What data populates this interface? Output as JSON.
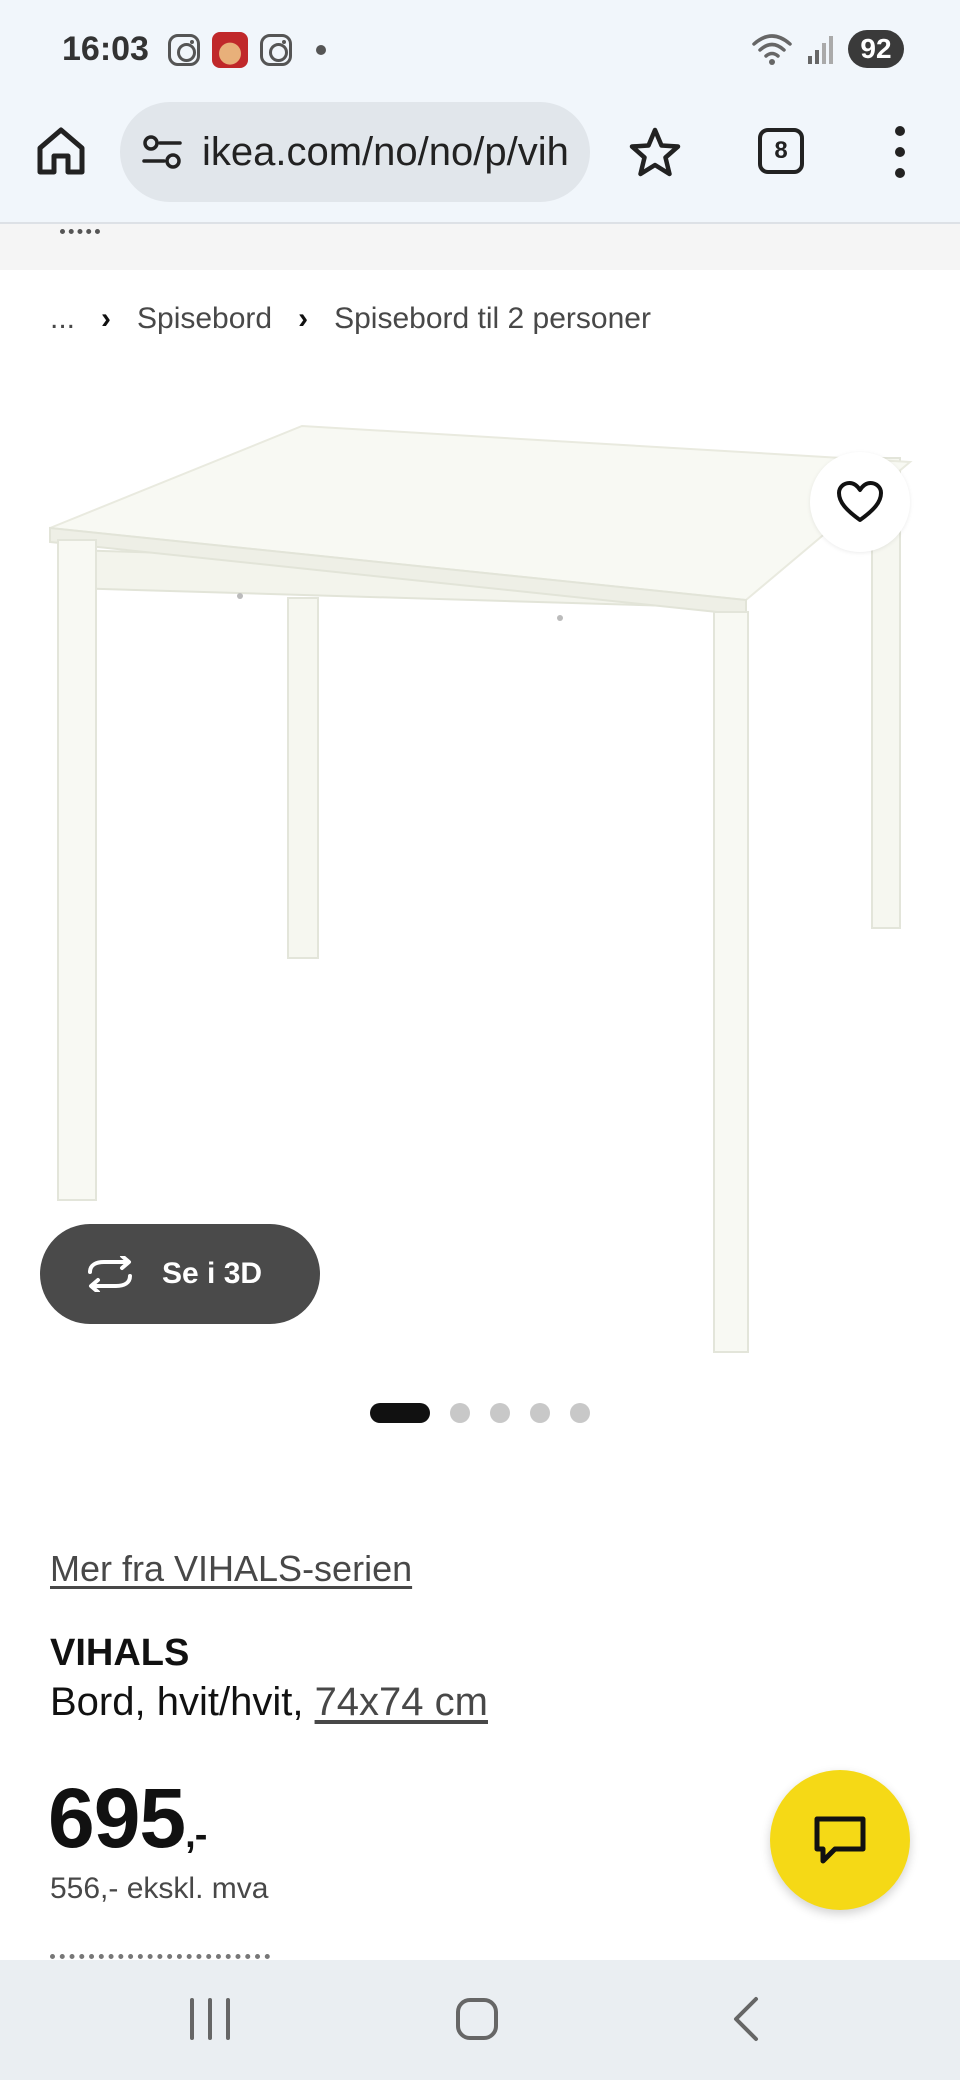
{
  "status_bar": {
    "time": "16:03",
    "battery": "92",
    "icons": [
      "instagram-icon",
      "game-app-icon",
      "instagram-icon",
      "notification-dot-icon",
      "wifi-icon",
      "signal-icon",
      "battery-icon"
    ]
  },
  "browser": {
    "url": "ikea.com/no/no/p/vih",
    "tab_count": "8"
  },
  "breadcrumb": {
    "items": [
      "...",
      "Spisebord",
      "Spisebord til 2 personer"
    ]
  },
  "product": {
    "view_3d_label": "Se i 3D",
    "carousel": {
      "total": 5,
      "active": 1
    },
    "series_link": "Mer fra VIHALS-serien",
    "name": "VIHALS",
    "description": "Bord, hvit/hvit,",
    "size": "74x74 cm",
    "price": "695",
    "price_suffix": ",-",
    "price_ex_vat": "556,- ekskl. mva"
  },
  "colors": {
    "accent_yellow": "#f5d916",
    "browser_bg": "#f1f6fb",
    "dark_button": "#4a4a4a"
  }
}
